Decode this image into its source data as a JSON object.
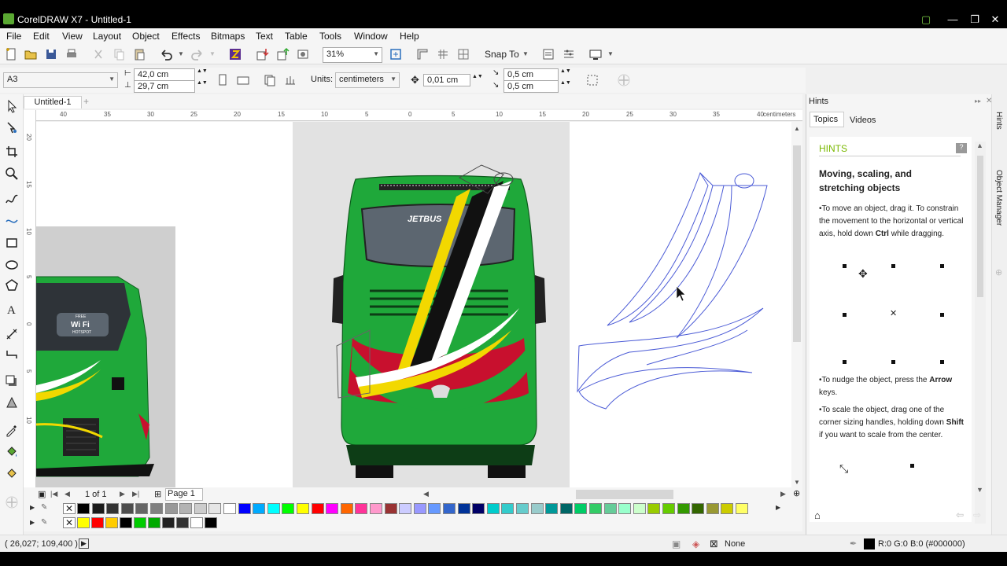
{
  "window": {
    "title": "CorelDRAW X7 - Untitled-1",
    "controls": [
      "▢",
      "—",
      "❐",
      "✕"
    ]
  },
  "menu": [
    "File",
    "Edit",
    "View",
    "Layout",
    "Object",
    "Effects",
    "Bitmaps",
    "Text",
    "Table",
    "Tools",
    "Window",
    "Help"
  ],
  "toolbar": {
    "zoom": "31%",
    "snap_to": "Snap To"
  },
  "propbar": {
    "page_size": "A3",
    "width": "42,0 cm",
    "height": "29,7 cm",
    "units_label": "Units:",
    "units": "centimeters",
    "nudge": "0,01 cm",
    "dup_x": "0,5 cm",
    "dup_y": "0,5 cm"
  },
  "doc_tab": "Untitled-1",
  "ruler": {
    "unit": "centimeters",
    "h_ticks": [
      "40",
      "35",
      "30",
      "25",
      "20",
      "15",
      "10",
      "5",
      "0",
      "5",
      "10",
      "15",
      "20",
      "25",
      "30",
      "35",
      "40"
    ],
    "v_ticks": [
      "20",
      "15",
      "10",
      "5",
      "0",
      "5",
      "10"
    ]
  },
  "page_nav": {
    "position": "1 of 1",
    "page_tab": "Page 1"
  },
  "palette": {
    "row1": [
      "#000000",
      "#1a1a1a",
      "#333333",
      "#4d4d4d",
      "#666666",
      "#808080",
      "#999999",
      "#b3b3b3",
      "#cccccc",
      "#e6e6e6",
      "#ffffff",
      "#0000ff",
      "#00aaff",
      "#00ffff",
      "#00ff00",
      "#ffff00",
      "#ff0000",
      "#ff00ff",
      "#ff6600",
      "#ff3399",
      "#ff99cc",
      "#993333",
      "#ccccff",
      "#9999ff",
      "#6699ff",
      "#3366cc",
      "#003399",
      "#000066",
      "#00cccc",
      "#33cccc",
      "#66cccc",
      "#99cccc",
      "#009999",
      "#006666",
      "#00cc66",
      "#33cc66",
      "#66cc99",
      "#99ffcc",
      "#ccffcc",
      "#99cc00",
      "#66cc00",
      "#339900",
      "#336600",
      "#999933",
      "#cccc00",
      "#ffff66"
    ],
    "row2": [
      "#ffff00",
      "#ff0000",
      "#ffcc00",
      "#000000",
      "#00cc00",
      "#00aa00",
      "#222222",
      "#333333",
      "#ffffff",
      "#000000"
    ]
  },
  "status": {
    "coords": "( 26,027; 109,400 )",
    "fill": "None",
    "outline": "R:0 G:0 B:0 (#000000)"
  },
  "docker": {
    "title": "Hints",
    "tabs": [
      "Topics",
      "Videos"
    ],
    "rail": [
      "Hints",
      "Object Manager"
    ],
    "heading": "HINTS",
    "topic": "Moving, scaling, and stretching objects",
    "p1_pre": "•To move an object, drag it. To constrain the movement to the horizontal or vertical axis, hold down ",
    "p1_key": "Ctrl",
    "p1_post": " while dragging.",
    "p2_pre": "•To nudge the object, press the ",
    "p2_key": "Arrow",
    "p2_post": " keys.",
    "p3_pre": "•To scale the object, drag one of the corner sizing handles, holding down ",
    "p3_key": "Shift",
    "p3_post": " if you want to scale from the center."
  },
  "canvas": {
    "bus_brand": "JETBUS",
    "wifi_top": "FREE",
    "wifi_label": "Wi Fi",
    "wifi_bottom": "HOTSPOT"
  },
  "colors": {
    "bus_green": "#1fa83a",
    "stripe_yellow": "#f2d800",
    "accent_red": "#c8102e",
    "outline_blue": "#4b5bd6"
  }
}
